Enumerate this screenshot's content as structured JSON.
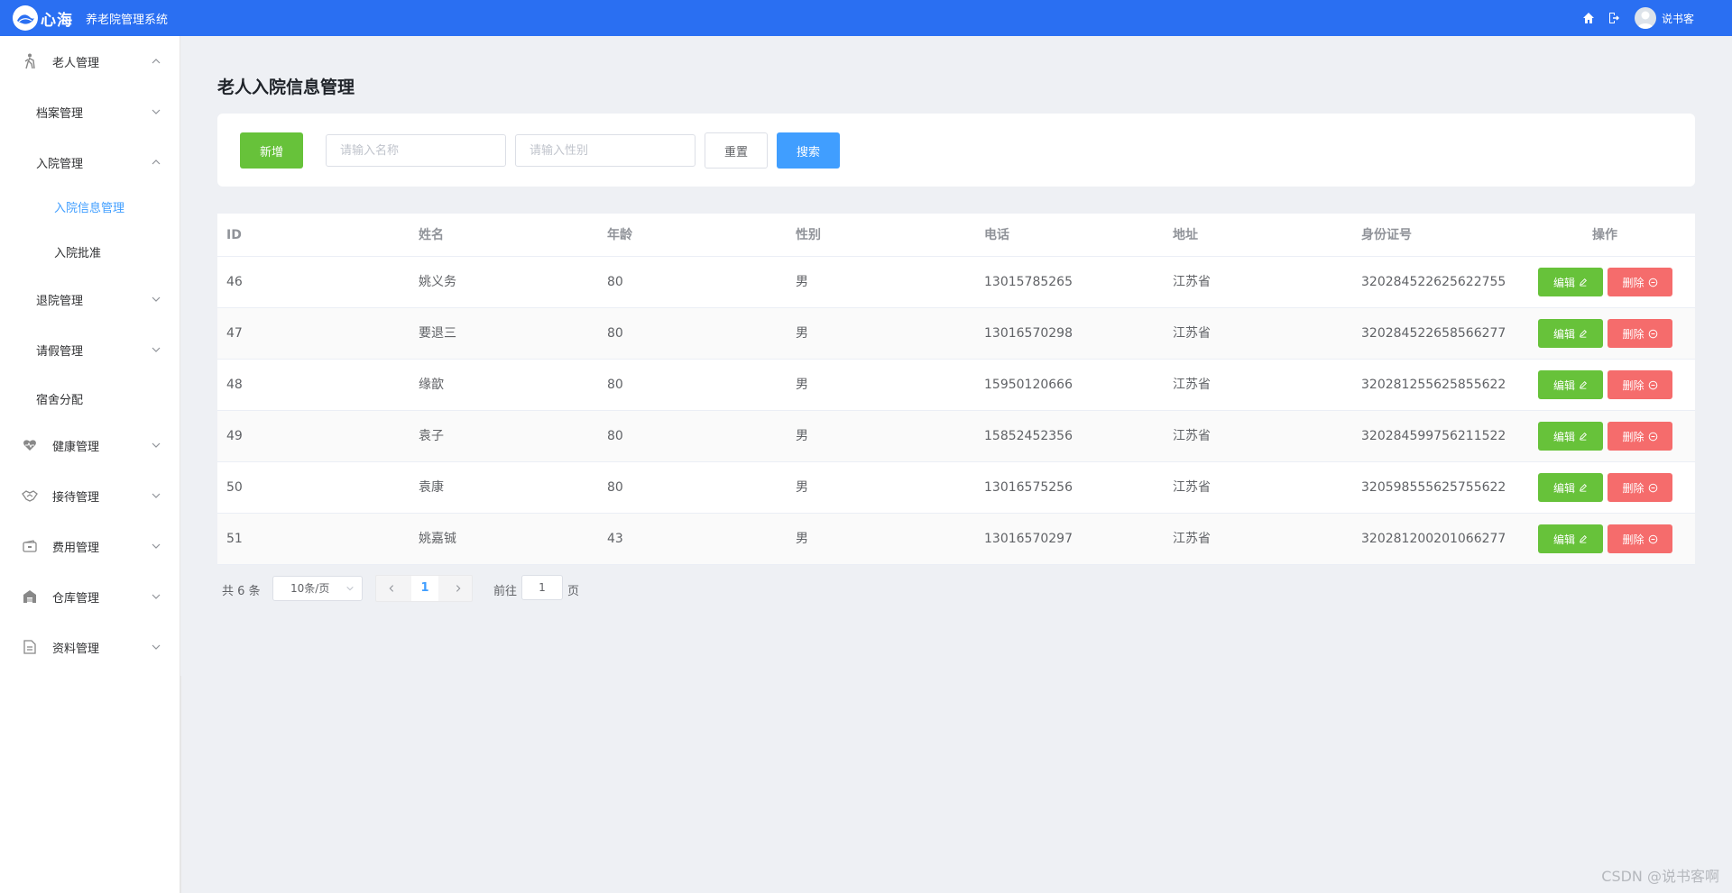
{
  "header": {
    "logo_text": "心海",
    "system_title": "养老院管理系统",
    "username": "说书客"
  },
  "sidebar": {
    "items": [
      {
        "label": "老人管理",
        "icon": "walking-person-icon",
        "level": 1,
        "expanded": true
      },
      {
        "label": "档案管理",
        "level": 2,
        "expanded": false
      },
      {
        "label": "入院管理",
        "level": 2,
        "expanded": true
      },
      {
        "label": "入院信息管理",
        "level": 3,
        "active": true
      },
      {
        "label": "入院批准",
        "level": 3
      },
      {
        "label": "退院管理",
        "level": 2,
        "expanded": false
      },
      {
        "label": "请假管理",
        "level": 2,
        "expanded": false
      },
      {
        "label": "宿舍分配",
        "level": 2
      },
      {
        "label": "健康管理",
        "icon": "heart-icon",
        "level": 1,
        "expanded": false
      },
      {
        "label": "接待管理",
        "icon": "handshake-icon",
        "level": 1,
        "expanded": false
      },
      {
        "label": "费用管理",
        "icon": "wallet-icon",
        "level": 1,
        "expanded": false
      },
      {
        "label": "仓库管理",
        "icon": "warehouse-icon",
        "level": 1,
        "expanded": false
      },
      {
        "label": "资料管理",
        "icon": "document-icon",
        "level": 1,
        "expanded": false
      }
    ]
  },
  "main": {
    "title": "老人入院信息管理",
    "add_label": "新增",
    "name_placeholder": "请输入名称",
    "gender_placeholder": "请输入性别",
    "reset_label": "重置",
    "search_label": "搜索"
  },
  "table": {
    "columns": [
      "ID",
      "姓名",
      "年龄",
      "性别",
      "电话",
      "地址",
      "身份证号",
      "操作"
    ],
    "rows": [
      [
        "46",
        "姚义务",
        "80",
        "男",
        "13015785265",
        "江苏省",
        "320284522625622755"
      ],
      [
        "47",
        "要退三",
        "80",
        "男",
        "13016570298",
        "江苏省",
        "320284522658566277"
      ],
      [
        "48",
        "缘歆",
        "80",
        "男",
        "15950120666",
        "江苏省",
        "320281255625855622"
      ],
      [
        "49",
        "袁子",
        "80",
        "男",
        "15852452356",
        "江苏省",
        "320284599756211522"
      ],
      [
        "50",
        "袁康",
        "80",
        "男",
        "13016575256",
        "江苏省",
        "320598555625755622"
      ],
      [
        "51",
        "姚嘉铖",
        "43",
        "男",
        "13016570297",
        "江苏省",
        "320281200201066277"
      ]
    ],
    "edit_label": "编辑",
    "delete_label": "删除"
  },
  "pagination": {
    "total_text": "共 6 条",
    "page_size": "10条/页",
    "current_page": "1",
    "goto_label": "前往",
    "goto_value": "1",
    "goto_unit": "页"
  },
  "watermark": "CSDN @说书客啊",
  "colors": {
    "header": "#2a6ff2",
    "primary": "#409eff",
    "success": "#67c23a",
    "danger": "#f56c6c"
  }
}
